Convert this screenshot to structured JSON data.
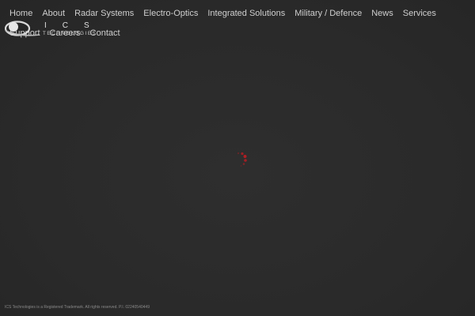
{
  "brand": {
    "logo_letters": "ICS",
    "logo_sub": "TECHNOLOGIES",
    "icon": "ics-logo-icon"
  },
  "nav": {
    "items": [
      {
        "label": "Home"
      },
      {
        "label": "About"
      },
      {
        "label": "Radar Systems"
      },
      {
        "label": "Electro-Optics"
      },
      {
        "label": "Integrated Solutions"
      },
      {
        "label": "Military / Defence"
      },
      {
        "label": "News"
      },
      {
        "label": "Services"
      },
      {
        "label": "Support"
      },
      {
        "label": "Careers"
      },
      {
        "label": "Contact"
      }
    ]
  },
  "loader": {
    "icon": "loading-spinner-icon",
    "color": "#b01e23"
  },
  "footer": {
    "text": "ICS Technologies is a Registered Trademark. All rights reserved. P.I. 02240540449"
  },
  "colors": {
    "background": "#2b2b2b",
    "nav_text": "#cfcfcf",
    "footer_text": "#8a8a8a",
    "accent": "#b01e23"
  }
}
